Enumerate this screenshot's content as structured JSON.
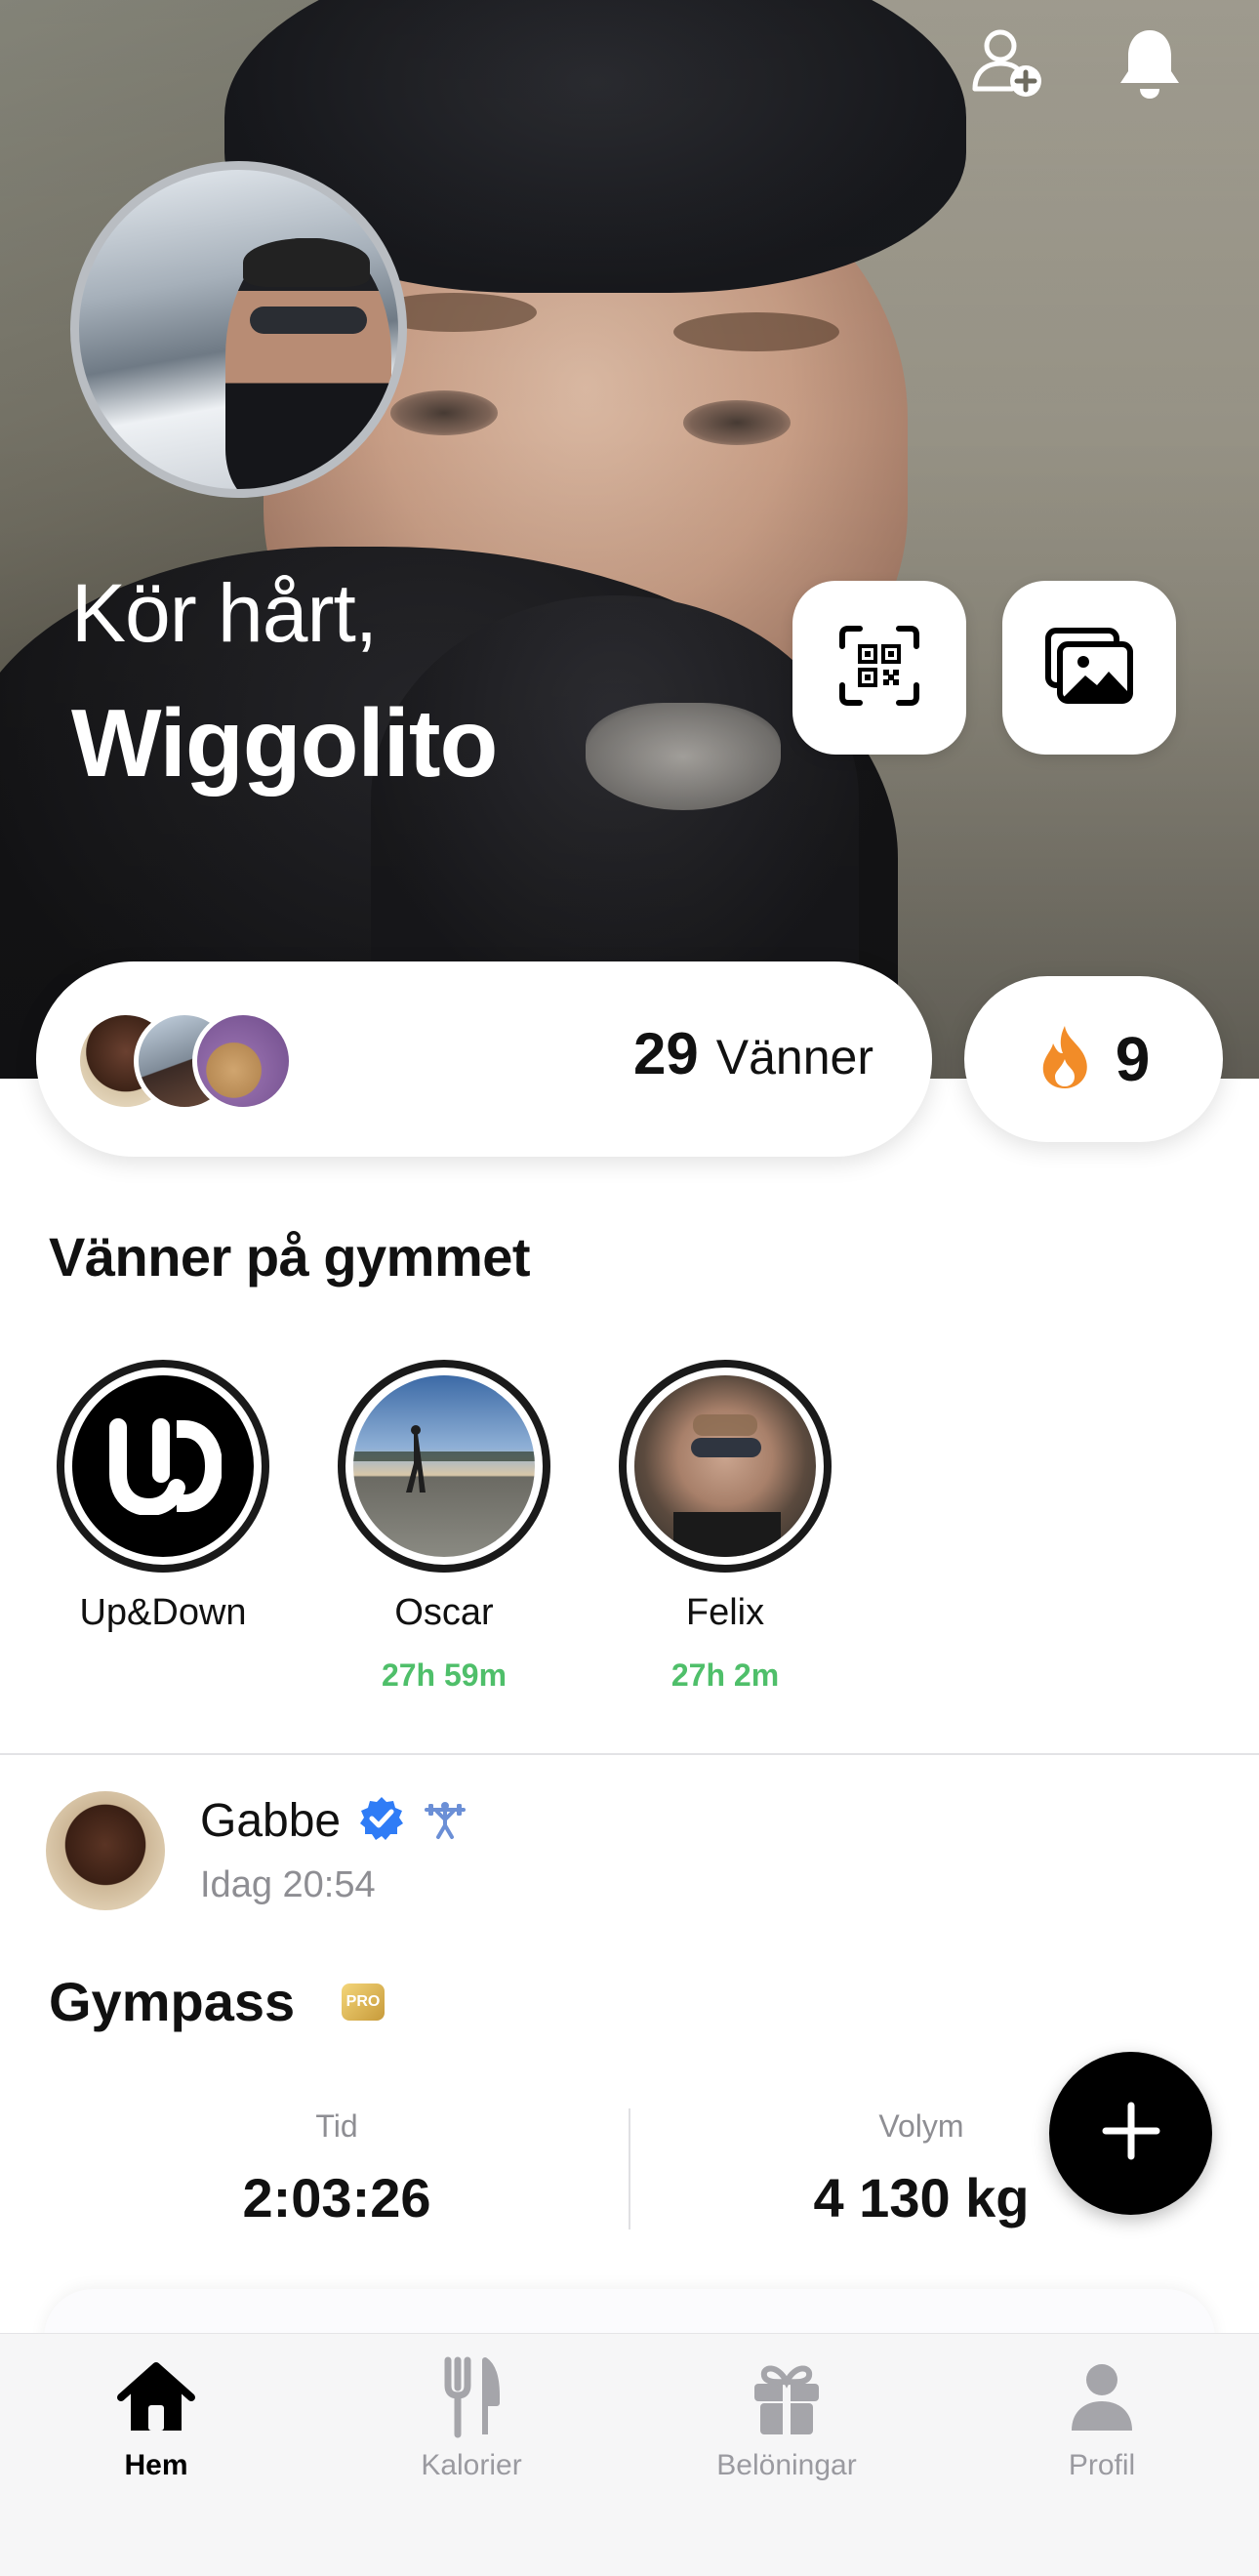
{
  "header": {
    "greeting": "Kör hårt,",
    "username": "Wiggolito",
    "icons": [
      "add-friend-icon",
      "bell-icon",
      "qr-scan-icon",
      "gallery-icon"
    ]
  },
  "friends": {
    "count": "29",
    "label": "Vänner",
    "streak": "9"
  },
  "gym_section": {
    "title": "Vänner på gymmet",
    "items": [
      {
        "name": "Up&Down",
        "time": ""
      },
      {
        "name": "Oscar",
        "time": "27h 59m"
      },
      {
        "name": "Felix",
        "time": "27h 2m"
      }
    ]
  },
  "post": {
    "user": "Gabbe",
    "time": "Idag 20:54",
    "title": "Gympass",
    "badge": "PRO",
    "stats": [
      {
        "label": "Tid",
        "value": "2:03:26"
      },
      {
        "label": "Volym",
        "value": "4 130 kg"
      }
    ]
  },
  "tabs": [
    {
      "label": "Hem",
      "icon": "home-icon",
      "active": true
    },
    {
      "label": "Kalorier",
      "icon": "fork-knife-icon",
      "active": false
    },
    {
      "label": "Belöningar",
      "icon": "gift-icon",
      "active": false
    },
    {
      "label": "Profil",
      "icon": "person-icon",
      "active": false
    }
  ],
  "colors": {
    "accent_green": "#4fbf6a",
    "flame_orange": "#f28c28",
    "verified_blue": "#2f7cf6"
  }
}
